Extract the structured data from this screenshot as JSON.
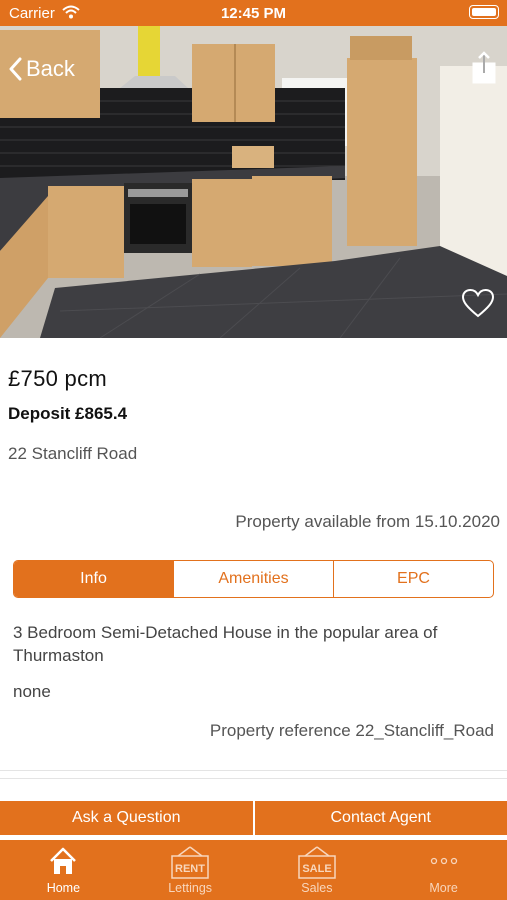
{
  "status_bar": {
    "carrier": "Carrier",
    "time": "12:45 PM"
  },
  "nav": {
    "back_label": "Back"
  },
  "listing": {
    "price": "£750 pcm",
    "deposit": "Deposit £865.4",
    "address": "22 Stancliff Road",
    "available": "Property available from 15.10.2020",
    "tabs": [
      {
        "label": "Info",
        "active": true
      },
      {
        "label": "Amenities",
        "active": false
      },
      {
        "label": "EPC",
        "active": false
      }
    ],
    "description": "3 Bedroom Semi-Detached House in the popular area of Thurmaston",
    "extra": "none",
    "reference": "Property reference 22_Stancliff_Road"
  },
  "actions": {
    "ask_question": "Ask a Question",
    "contact_agent": "Contact Agent"
  },
  "tabbar": {
    "items": [
      {
        "label": "Home",
        "icon": "home-icon"
      },
      {
        "label": "Lettings",
        "icon": "rent-sign-icon",
        "badge": "RENT"
      },
      {
        "label": "Sales",
        "icon": "sale-sign-icon",
        "badge": "SALE"
      },
      {
        "label": "More",
        "icon": "more-dots-icon"
      }
    ]
  },
  "colors": {
    "accent": "#e2711d"
  }
}
